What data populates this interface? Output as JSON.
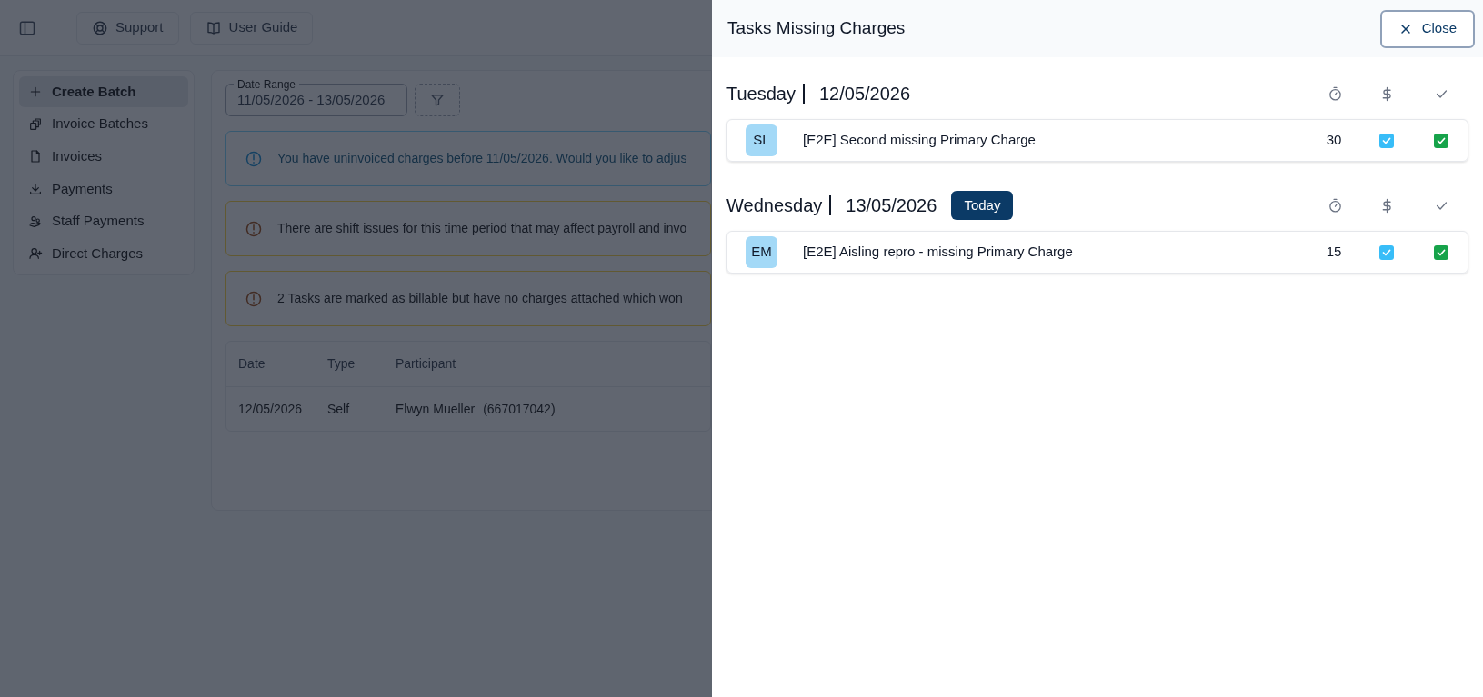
{
  "top_bar": {
    "buttons": [
      {
        "kind": "support",
        "label": "Support"
      },
      {
        "kind": "guide",
        "label": "User Guide"
      }
    ]
  },
  "sidebar": {
    "items": [
      {
        "kind": "plus",
        "label": "Create Batch",
        "selected": true
      },
      {
        "kind": "batches",
        "label": "Invoice Batches",
        "selected": false
      },
      {
        "kind": "file",
        "label": "Invoices",
        "selected": false
      },
      {
        "kind": "download",
        "label": "Payments",
        "selected": false
      },
      {
        "kind": "staff",
        "label": "Staff Payments",
        "selected": false
      },
      {
        "kind": "user",
        "label": "Direct Charges",
        "selected": false
      }
    ]
  },
  "date_range": {
    "label": "Date Range",
    "value": "11/05/2026 - 13/05/2026"
  },
  "alerts": [
    {
      "kind": "info",
      "text": "You have uninvoiced charges before 11/05/2026. Would you like to adjus"
    },
    {
      "kind": "warning",
      "text": "There are shift issues for this time period that may affect payroll and invo"
    },
    {
      "kind": "warning",
      "text": "2 Tasks are marked as billable but have no charges attached which won"
    }
  ],
  "table": {
    "columns": [
      "Date",
      "Type",
      "Participant"
    ],
    "rows": [
      {
        "date": "12/05/2026",
        "type": "Self",
        "participant": "Elwyn Mueller",
        "participant_id": "(667017042)"
      }
    ]
  },
  "panel": {
    "title": "Tasks Missing Charges",
    "close_label": "Close",
    "days": [
      {
        "weekday": "Tuesday",
        "date": "12/05/2026",
        "today": false,
        "tasks": [
          {
            "initials": "SL",
            "name": "[E2E] Second missing Primary Charge",
            "minutes": "30",
            "billable": true,
            "done": true
          }
        ]
      },
      {
        "weekday": "Wednesday",
        "date": "13/05/2026",
        "today": true,
        "today_label": "Today",
        "tasks": [
          {
            "initials": "EM",
            "name": "[E2E] Aisling repro - missing Primary Charge",
            "minutes": "15",
            "billable": true,
            "done": true
          }
        ]
      }
    ]
  }
}
